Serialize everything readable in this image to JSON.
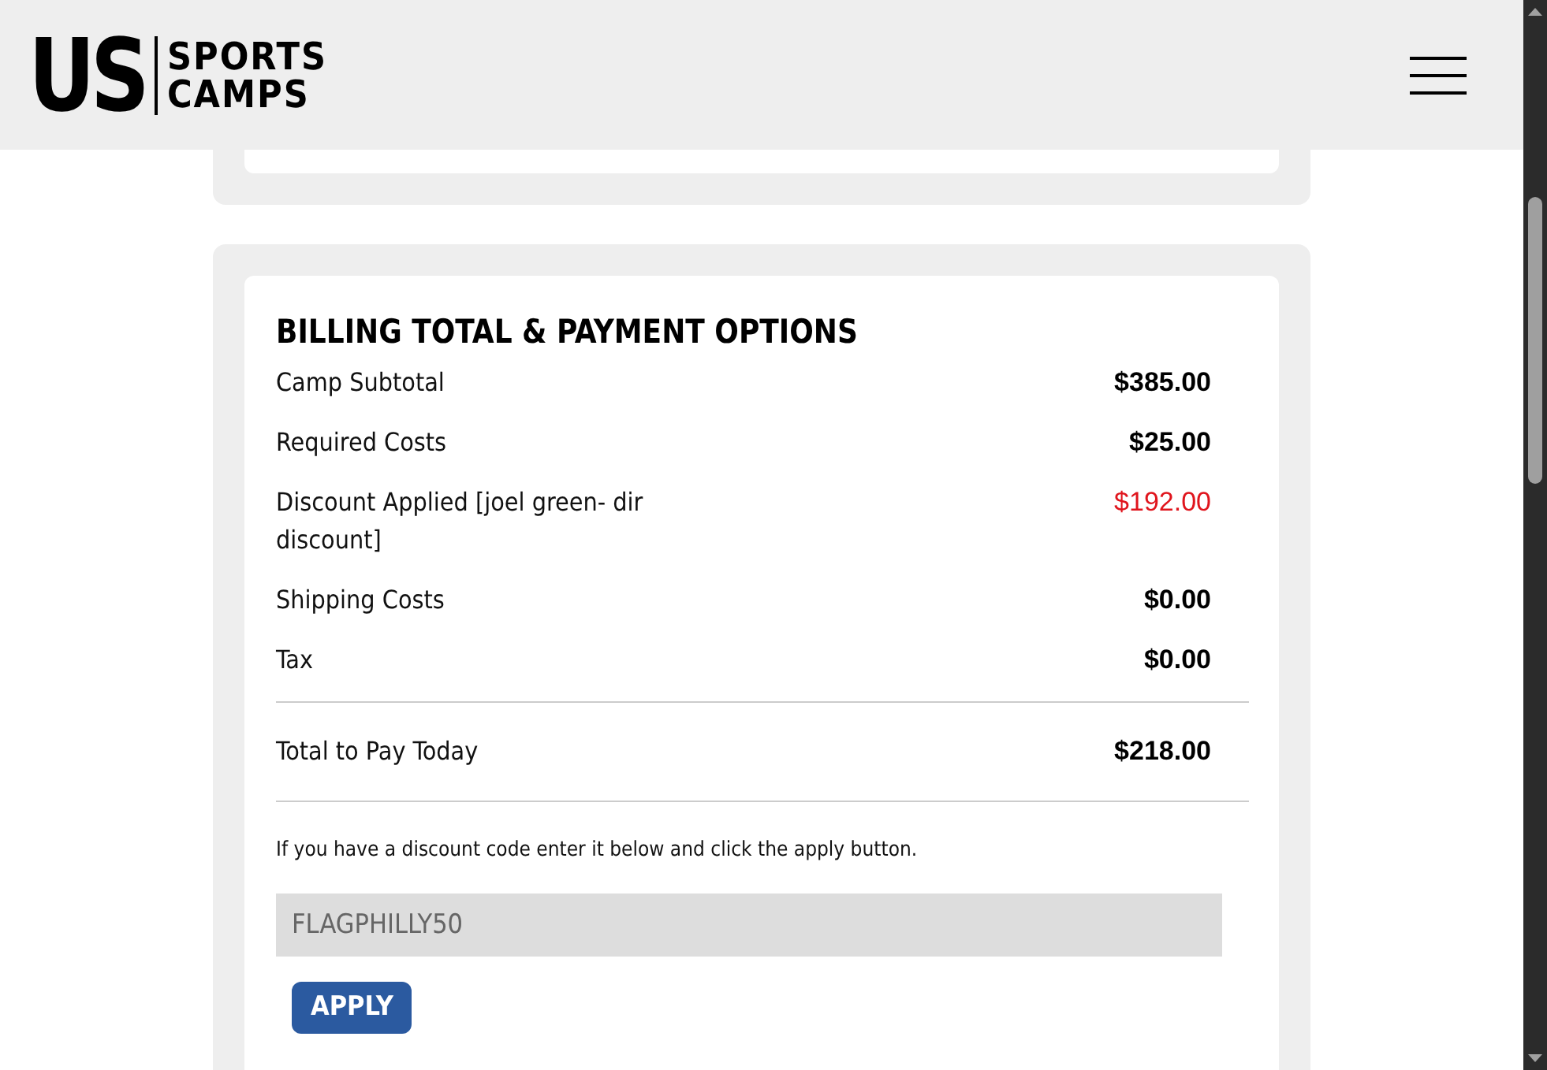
{
  "header": {
    "logo": {
      "big": "US",
      "line1": "SPORTS",
      "line2": "CAMPS"
    }
  },
  "billing": {
    "title": "BILLING TOTAL & PAYMENT OPTIONS",
    "lines": [
      {
        "label": "Camp Subtotal",
        "amount": "$385.00",
        "kind": "charge"
      },
      {
        "label": "Required Costs",
        "amount": "$25.00",
        "kind": "charge"
      },
      {
        "label": "Discount Applied [joel green- dir discount]",
        "amount": "$192.00",
        "kind": "discount"
      },
      {
        "label": "Shipping Costs",
        "amount": "$0.00",
        "kind": "charge"
      },
      {
        "label": "Tax",
        "amount": "$0.00",
        "kind": "charge"
      }
    ],
    "total": {
      "label": "Total to Pay Today",
      "amount": "$218.00"
    },
    "discount_hint": "If you have a discount code enter it below and click the apply button.",
    "discount_field": {
      "value": "FLAGPHILLY50"
    },
    "apply_button": "APPLY"
  }
}
